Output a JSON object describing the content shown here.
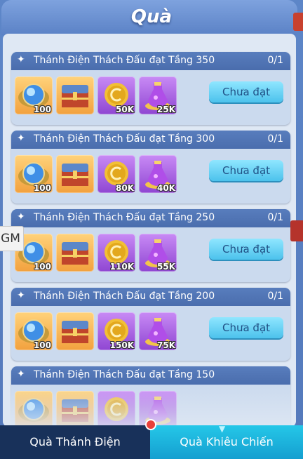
{
  "title": "Quà",
  "gm_label": "GM",
  "cards": [
    {
      "star": "✦",
      "title": "Thánh Điện Thách Đấu đạt Tầng 350",
      "progress": "0/1",
      "button": "Chưa đạt",
      "rewards": [
        {
          "icon": "blue-gem-icon",
          "qty": "100"
        },
        {
          "icon": "treasure-chest-icon",
          "qty": ""
        },
        {
          "icon": "gold-coin-icon",
          "qty": "50K"
        },
        {
          "icon": "purple-potion-icon",
          "qty": "25K"
        }
      ]
    },
    {
      "star": "✦",
      "title": "Thánh Điện Thách Đấu đạt Tầng 300",
      "progress": "0/1",
      "button": "Chưa đạt",
      "rewards": [
        {
          "icon": "blue-gem-icon",
          "qty": "100"
        },
        {
          "icon": "treasure-chest-icon",
          "qty": ""
        },
        {
          "icon": "gold-coin-icon",
          "qty": "80K"
        },
        {
          "icon": "purple-potion-icon",
          "qty": "40K"
        }
      ]
    },
    {
      "star": "✦",
      "title": "Thánh Điện Thách Đấu đạt Tầng 250",
      "progress": "0/1",
      "button": "Chưa đạt",
      "rewards": [
        {
          "icon": "blue-gem-icon",
          "qty": "100"
        },
        {
          "icon": "treasure-chest-icon",
          "qty": ""
        },
        {
          "icon": "gold-coin-icon",
          "qty": "110K"
        },
        {
          "icon": "purple-potion-icon",
          "qty": "55K"
        }
      ]
    },
    {
      "star": "✦",
      "title": "Thánh Điện Thách Đấu đạt Tầng 200",
      "progress": "0/1",
      "button": "Chưa đạt",
      "rewards": [
        {
          "icon": "blue-gem-icon",
          "qty": "100"
        },
        {
          "icon": "treasure-chest-icon",
          "qty": ""
        },
        {
          "icon": "gold-coin-icon",
          "qty": "150K"
        },
        {
          "icon": "purple-potion-icon",
          "qty": "75K"
        }
      ]
    },
    {
      "star": "✦",
      "title": "Thánh Điện Thách Đấu đạt Tầng 150",
      "progress": "",
      "button": "",
      "rewards": [
        {
          "icon": "blue-gem-icon",
          "qty": ""
        },
        {
          "icon": "treasure-chest-icon",
          "qty": ""
        },
        {
          "icon": "gold-coin-icon",
          "qty": ""
        },
        {
          "icon": "purple-potion-icon",
          "qty": ""
        }
      ]
    }
  ],
  "tabs": [
    {
      "label": "Quà Thánh Điện",
      "active": false
    },
    {
      "label": "Quà Khiêu Chiến",
      "active": true
    }
  ],
  "colors": {
    "accent": "#4cc2ec",
    "header": "#4a6dad",
    "tab_inactive": "#18315a"
  }
}
